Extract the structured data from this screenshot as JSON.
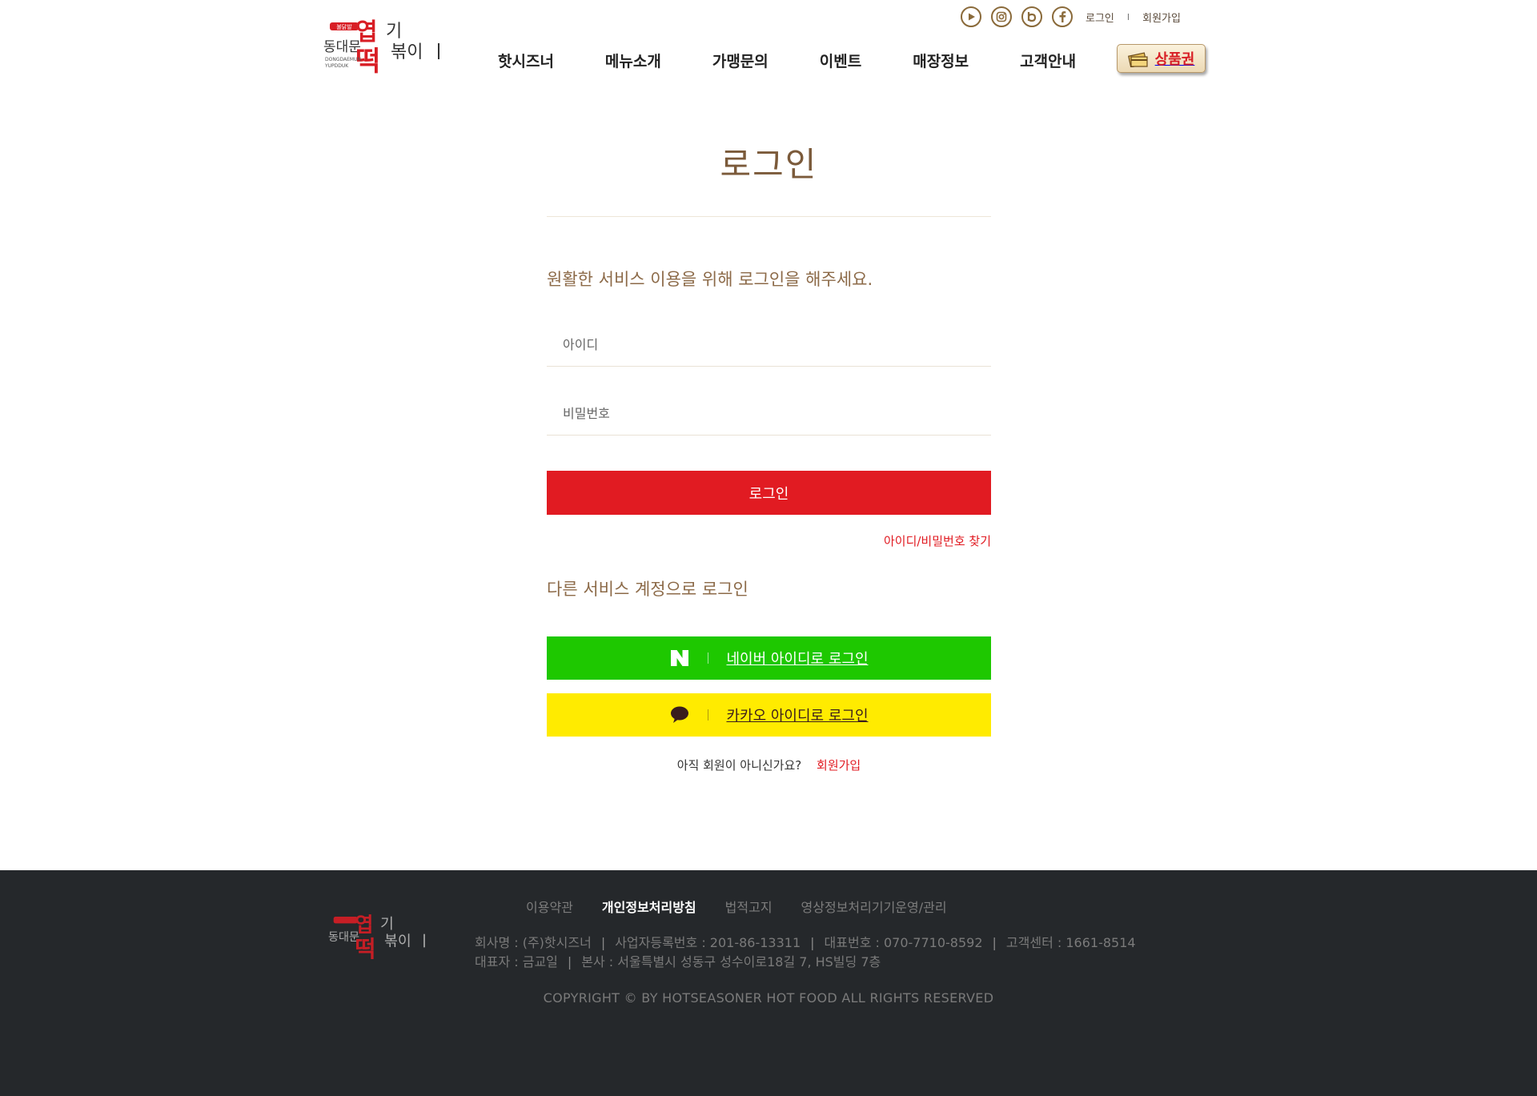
{
  "header": {
    "logo_text": "동대문엽기떡볶이",
    "util_links": {
      "login": "로그인",
      "join": "회원가입",
      "separator": "I"
    },
    "sns": [
      "youtube-icon",
      "instagram-icon",
      "blog-icon",
      "facebook-icon"
    ],
    "nav": [
      "핫시즈너",
      "메뉴소개",
      "가맹문의",
      "이벤트",
      "매장정보",
      "고객안내"
    ],
    "gift_button": "상품권"
  },
  "login": {
    "title": "로그인",
    "guide": "원활한 서비스 이용을 위해 로그인을 해주세요.",
    "id_placeholder": "아이디",
    "pw_placeholder": "비밀번호",
    "login_button": "로그인",
    "find_link": "아이디/비밀번호 찾기",
    "other_title": "다른 서비스 계정으로 로그인",
    "naver_button": "네이버 아이디로 로그인",
    "kakao_button": "카카오 아이디로 로그인",
    "join_prompt": "아직 회원이 아니신가요?",
    "join_link": "회원가입"
  },
  "footer": {
    "links": [
      "이용약관",
      "개인정보처리방침",
      "법적고지",
      "영상정보처리기기운영/관리"
    ],
    "company": "회사명 : (주)핫시즈너",
    "biz_no": "사업자등록번호 : 201-86-13311",
    "tel": "대표번호 : 070-7710-8592",
    "center": "고객센터 : 1661-8514",
    "ceo": "대표자 : 금교일",
    "address": "본사 : 서울특별시 성동구 성수이로18길 7, HS빌딩 7층",
    "copyright": "COPYRIGHT © BY HOTSEASONER HOT FOOD ALL RIGHTS RESERVED"
  },
  "colors": {
    "accent": "#e11b22",
    "brown": "#8c6a48",
    "naver": "#1ec800",
    "kakao": "#ffeb00",
    "footer_bg": "#25282b"
  }
}
